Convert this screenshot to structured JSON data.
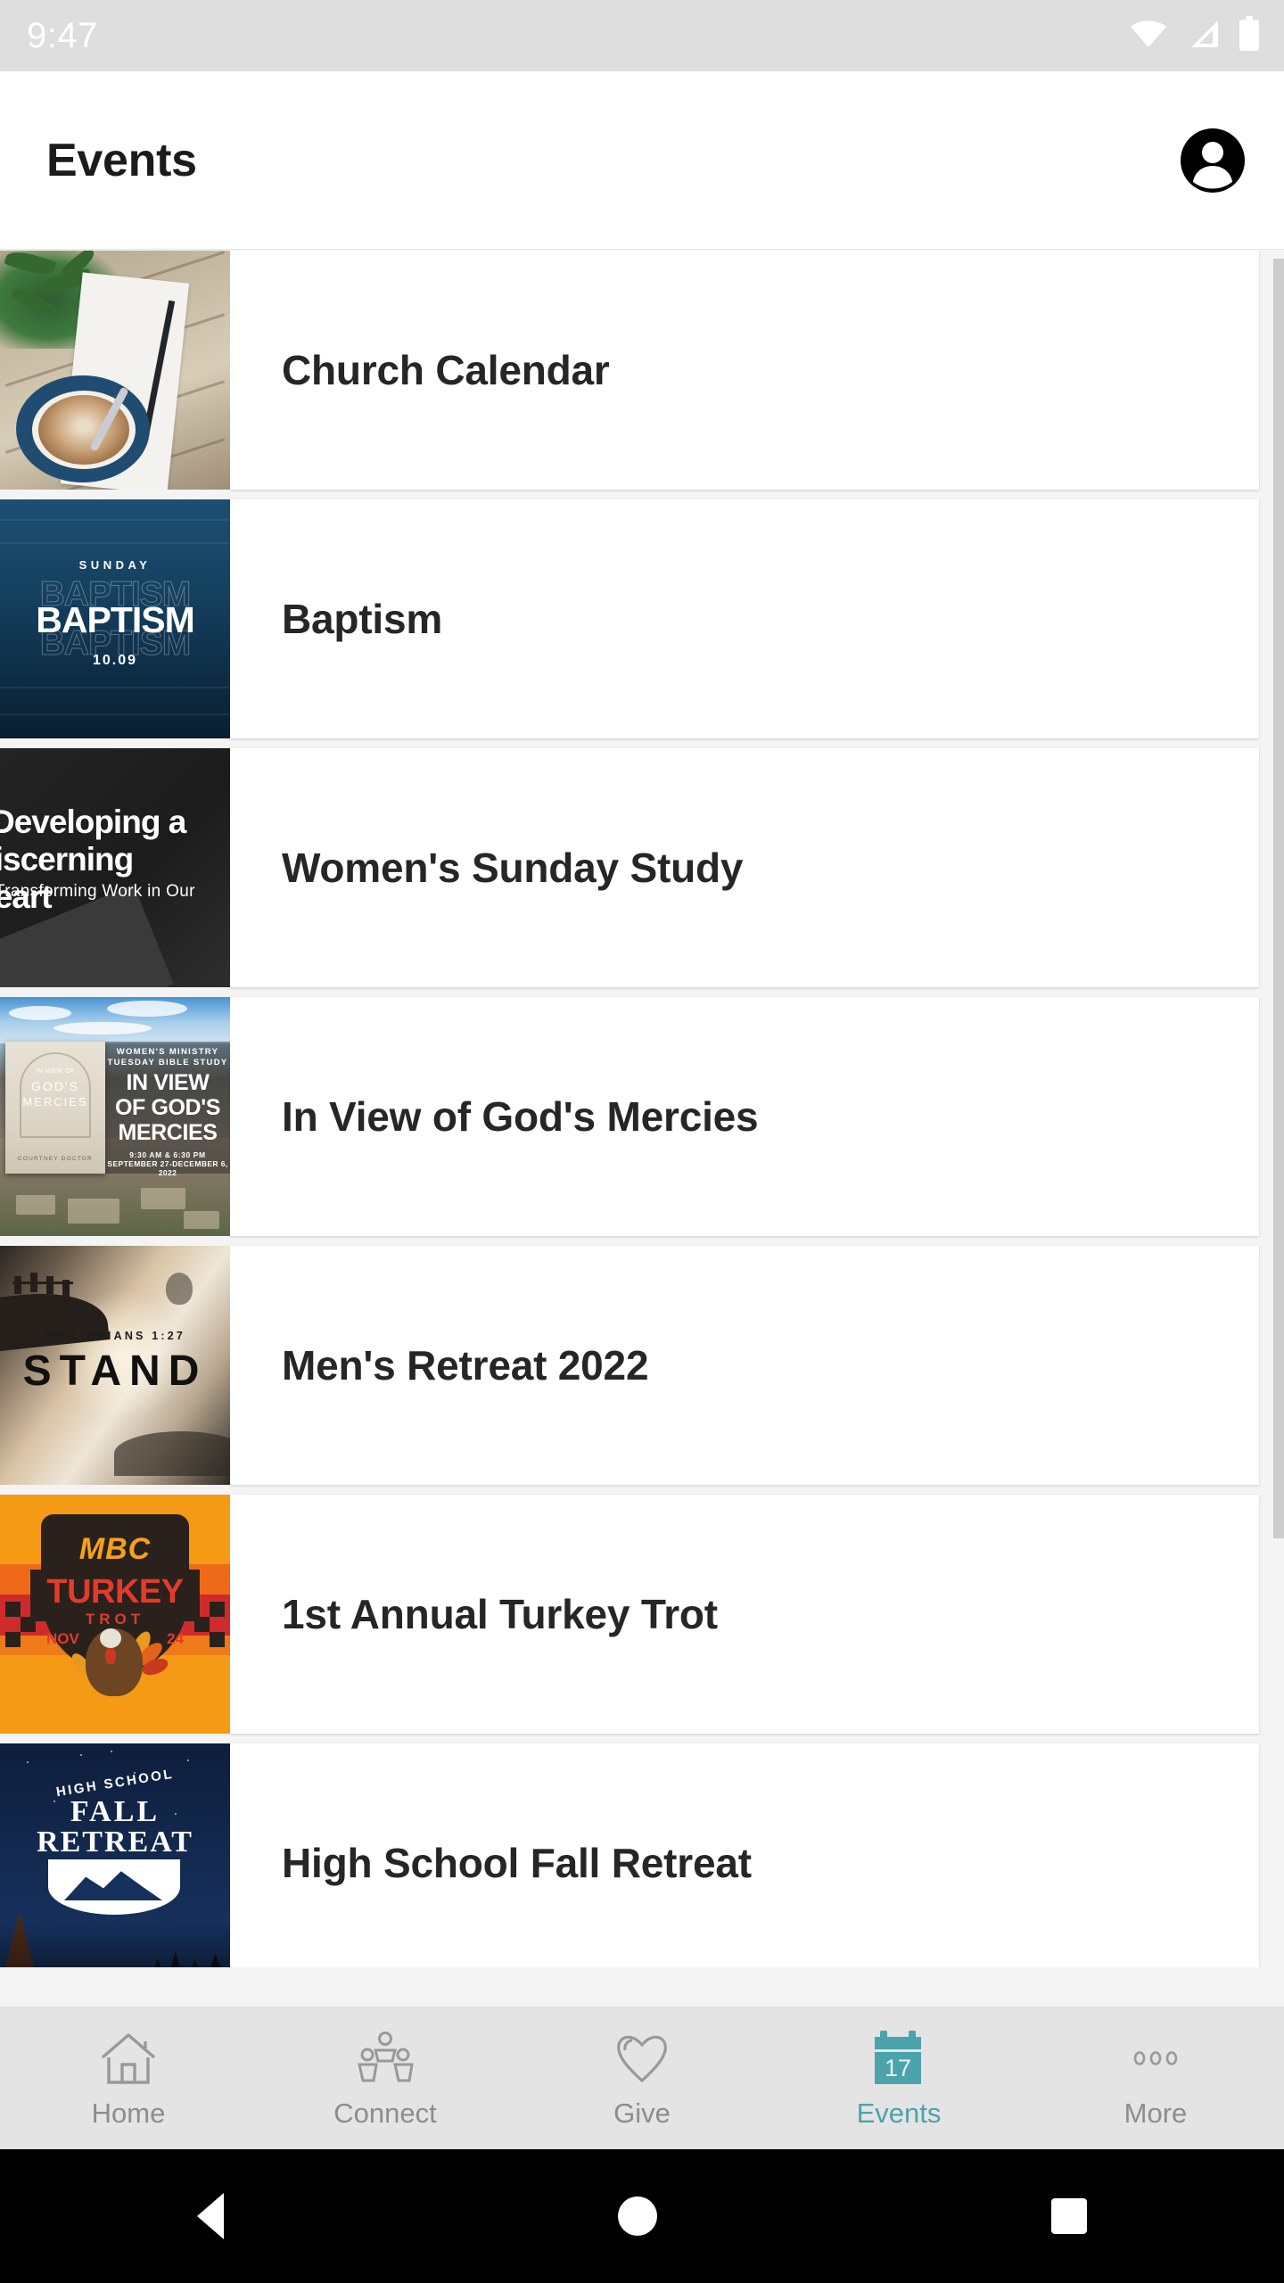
{
  "status_bar": {
    "time": "9:47",
    "icons": [
      "wifi-icon",
      "cellular-signal-icon",
      "battery-icon"
    ]
  },
  "header": {
    "title": "Events",
    "account_icon": "account-avatar-icon"
  },
  "events": [
    {
      "title": "Church Calendar",
      "thumbnail": {
        "kind": "photo-coffee-planner",
        "text": []
      }
    },
    {
      "title": "Baptism",
      "thumbnail": {
        "kind": "baptism-poster",
        "text": [
          "SUNDAY",
          "BAPTISM",
          "BAPTISM",
          "BAPTISM",
          "10.09"
        ]
      }
    },
    {
      "title": "Women's Sunday Study",
      "thumbnail": {
        "kind": "discerning-heart-poster",
        "text": [
          "Developing a",
          "Discerning Heart",
          "Transforming Work in Our"
        ]
      }
    },
    {
      "title": "In View of God's Mercies",
      "thumbnail": {
        "kind": "mercies-poster",
        "text": [
          "WOMEN'S MINISTRY",
          "TUESDAY BIBLE STUDY",
          "IN VIEW",
          "OF GOD'S",
          "MERCIES",
          "9:30 AM & 6:30 PM",
          "SEPTEMBER 27-DECEMBER 6, 2022",
          "IN VIEW OF",
          "GOD'S",
          "MERCIES",
          "COURTNEY DOCTOR"
        ]
      }
    },
    {
      "title": "Men's Retreat 2022",
      "thumbnail": {
        "kind": "stand-poster",
        "text": [
          "PHILIPPIANS 1:27",
          "STAND"
        ]
      }
    },
    {
      "title": "1st Annual Turkey Trot",
      "thumbnail": {
        "kind": "turkey-trot-poster",
        "text": [
          "MBC",
          "TURKEY",
          "TROT",
          "NOV",
          "24"
        ]
      }
    },
    {
      "title": "High School Fall Retreat",
      "thumbnail": {
        "kind": "fall-retreat-poster",
        "text": [
          "HIGH SCHOOL",
          "FALL",
          "RETREAT"
        ]
      }
    }
  ],
  "tabs": [
    {
      "label": "Home",
      "icon": "home-icon",
      "active": false
    },
    {
      "label": "Connect",
      "icon": "people-icon",
      "active": false
    },
    {
      "label": "Give",
      "icon": "heart-icon",
      "active": false
    },
    {
      "label": "Events",
      "icon": "calendar-icon",
      "active": true,
      "calendar_day": "17"
    },
    {
      "label": "More",
      "icon": "more-dots-icon",
      "active": false
    }
  ],
  "android_nav": {
    "back": "back-triangle-icon",
    "home": "home-circle-icon",
    "recents": "recents-square-icon"
  },
  "colors": {
    "accent_teal": "#4ba3ac",
    "status_bar_bg": "#dedede",
    "tabbar_bg": "#e4e4e4",
    "list_bg": "#f4f4f4",
    "title_text": "#262626",
    "inactive_tab": "#8d8d8d"
  }
}
